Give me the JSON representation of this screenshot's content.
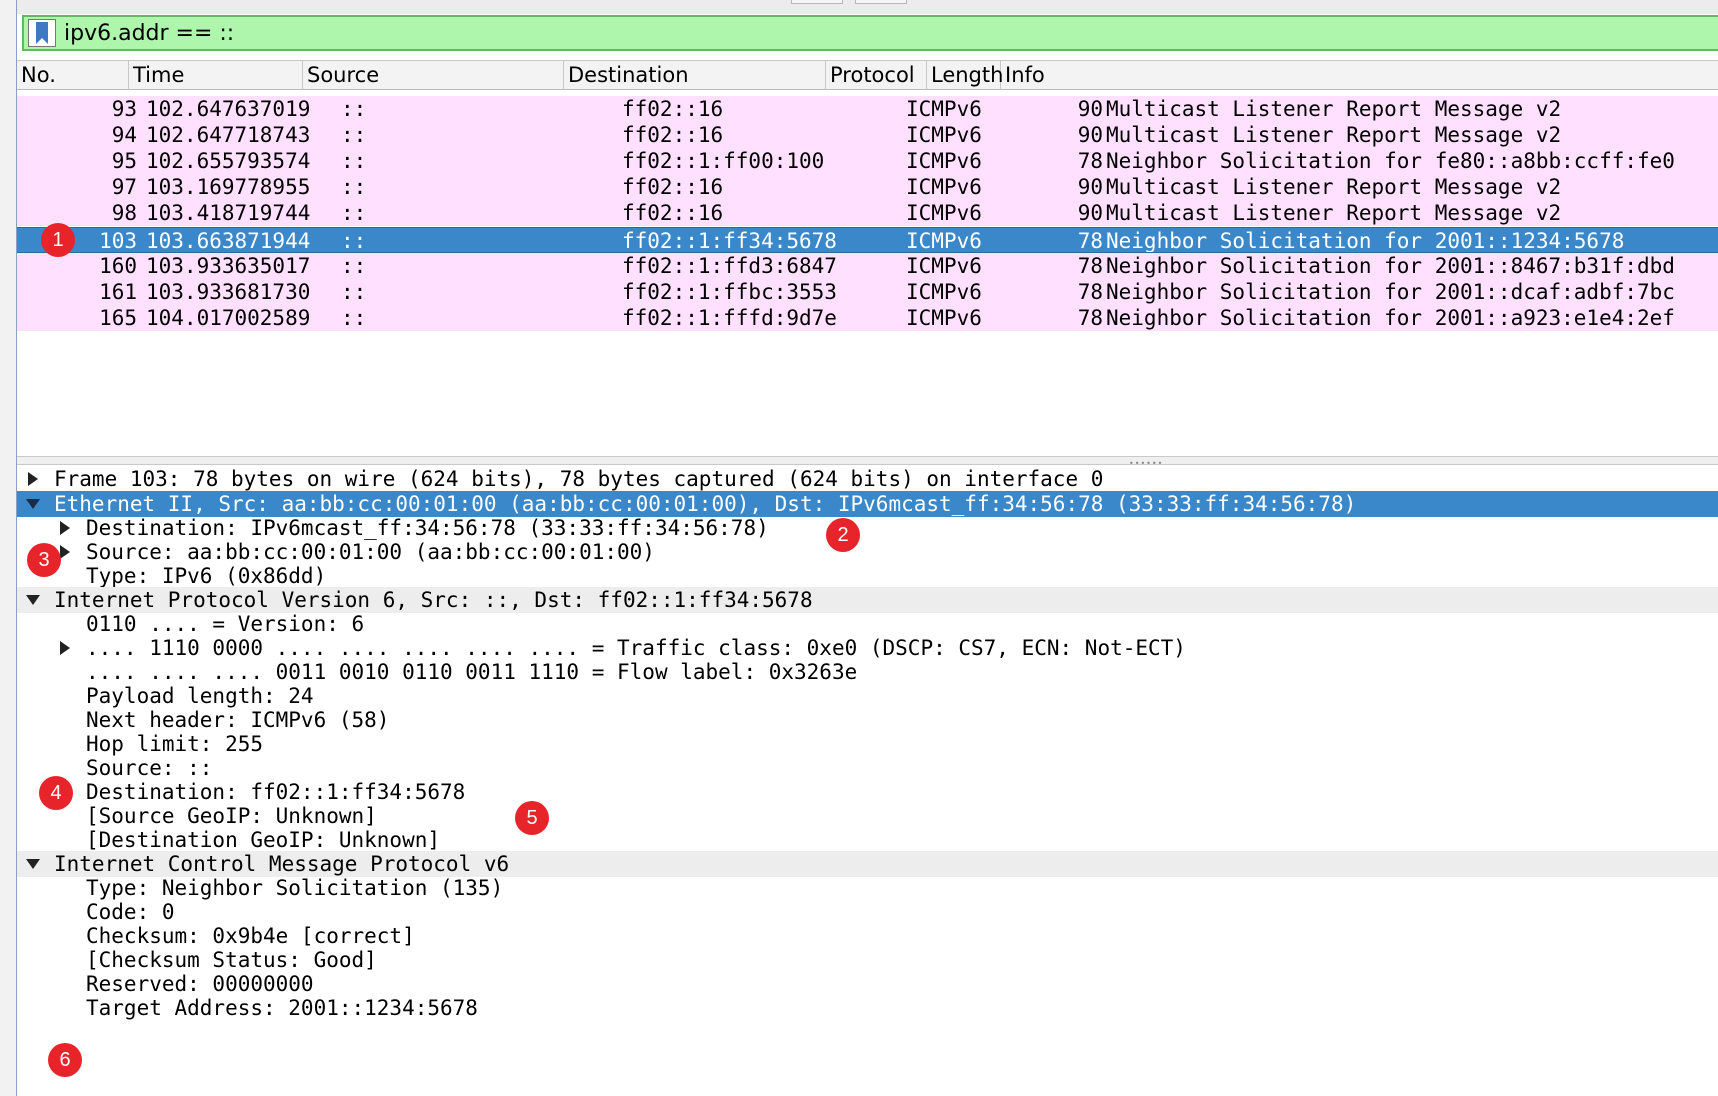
{
  "filter": {
    "value": "ipv6.addr == ::"
  },
  "columns": [
    "No.",
    "Time",
    "Source",
    "Destination",
    "Protocol",
    "Length",
    "Info"
  ],
  "packets": [
    {
      "no": "93",
      "time": "102.647637019",
      "src": "::",
      "dst": "ff02::16",
      "proto": "ICMPv6",
      "len": "90",
      "info": "Multicast Listener Report Message v2"
    },
    {
      "no": "94",
      "time": "102.647718743",
      "src": "::",
      "dst": "ff02::16",
      "proto": "ICMPv6",
      "len": "90",
      "info": "Multicast Listener Report Message v2"
    },
    {
      "no": "95",
      "time": "102.655793574",
      "src": "::",
      "dst": "ff02::1:ff00:100",
      "proto": "ICMPv6",
      "len": "78",
      "info": "Neighbor Solicitation for fe80::a8bb:ccff:fe0"
    },
    {
      "no": "97",
      "time": "103.169778955",
      "src": "::",
      "dst": "ff02::16",
      "proto": "ICMPv6",
      "len": "90",
      "info": "Multicast Listener Report Message v2"
    },
    {
      "no": "98",
      "time": "103.418719744",
      "src": "::",
      "dst": "ff02::16",
      "proto": "ICMPv6",
      "len": "90",
      "info": "Multicast Listener Report Message v2"
    },
    {
      "no": "103",
      "time": "103.663871944",
      "src": "::",
      "dst": "ff02::1:ff34:5678",
      "proto": "ICMPv6",
      "len": "78",
      "info": "Neighbor Solicitation for 2001::1234:5678"
    },
    {
      "no": "160",
      "time": "103.933635017",
      "src": "::",
      "dst": "ff02::1:ffd3:6847",
      "proto": "ICMPv6",
      "len": "78",
      "info": "Neighbor Solicitation for 2001::8467:b31f:dbd"
    },
    {
      "no": "161",
      "time": "103.933681730",
      "src": "::",
      "dst": "ff02::1:ffbc:3553",
      "proto": "ICMPv6",
      "len": "78",
      "info": "Neighbor Solicitation for 2001::dcaf:adbf:7bc"
    },
    {
      "no": "165",
      "time": "104.017002589",
      "src": "::",
      "dst": "ff02::1:fffd:9d7e",
      "proto": "ICMPv6",
      "len": "78",
      "info": "Neighbor Solicitation for 2001::a923:e1e4:2ef"
    }
  ],
  "details": [
    "Frame 103: 78 bytes on wire (624 bits), 78 bytes captured (624 bits) on interface 0",
    "Ethernet II, Src: aa:bb:cc:00:01:00 (aa:bb:cc:00:01:00), Dst: IPv6mcast_ff:34:56:78 (33:33:ff:34:56:78)",
    "Destination: IPv6mcast_ff:34:56:78 (33:33:ff:34:56:78)",
    "Source: aa:bb:cc:00:01:00 (aa:bb:cc:00:01:00)",
    "Type: IPv6 (0x86dd)",
    "Internet Protocol Version 6, Src: ::, Dst: ff02::1:ff34:5678",
    "0110 .... = Version: 6",
    ".... 1110 0000 .... .... .... .... .... = Traffic class: 0xe0 (DSCP: CS7, ECN: Not-ECT)",
    ".... .... .... 0011 0010 0110 0011 1110 = Flow label: 0x3263e",
    "Payload length: 24",
    "Next header: ICMPv6 (58)",
    "Hop limit: 255",
    "Source: ::",
    "Destination: ff02::1:ff34:5678",
    "[Source GeoIP: Unknown]",
    "[Destination GeoIP: Unknown]",
    "Internet Control Message Protocol v6",
    "Type: Neighbor Solicitation (135)",
    "Code: 0",
    "Checksum: 0x9b4e [correct]",
    "[Checksum Status: Good]",
    "Reserved: 00000000",
    "Target Address: 2001::1234:5678"
  ],
  "badges": [
    "1",
    "2",
    "3",
    "4",
    "5",
    "6"
  ],
  "colors": {
    "filter_bg": "#aff6ad",
    "row_bg": "#ffe0ff",
    "selected_bg": "#3a87c9",
    "badge": "#e8242b"
  }
}
